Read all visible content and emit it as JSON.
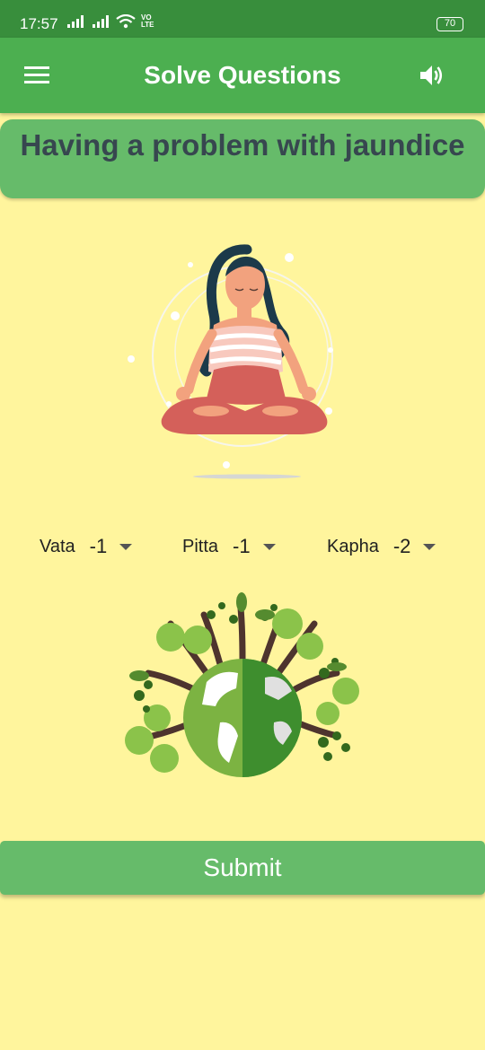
{
  "status_bar": {
    "time": "17:57",
    "network": "VO LTE",
    "battery": "70"
  },
  "app_bar": {
    "title": "Solve Questions"
  },
  "question": {
    "text": "Having a problem with jaundice"
  },
  "doshas": [
    {
      "label": "Vata",
      "value": "-1"
    },
    {
      "label": "Pitta",
      "value": "-1"
    },
    {
      "label": "Kapha",
      "value": "-2"
    }
  ],
  "submit": {
    "label": "Submit"
  },
  "colors": {
    "primary": "#4CAF50",
    "primary_dark": "#388E3C",
    "card": "#66BB6A",
    "background": "#FFF59D",
    "text": "#37474F"
  },
  "icons": [
    "menu-icon",
    "volume-icon",
    "signal-icon",
    "wifi-icon",
    "battery-icon"
  ]
}
